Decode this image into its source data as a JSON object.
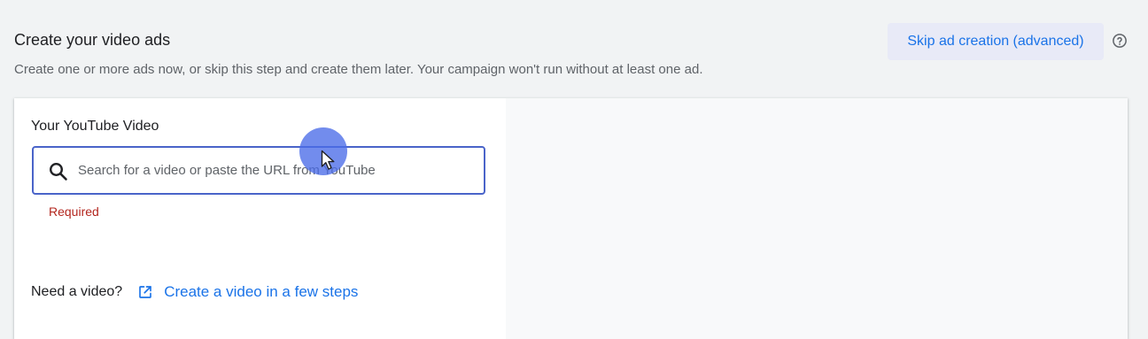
{
  "header": {
    "title": "Create your video ads",
    "subtitle": "Create one or more ads now, or skip this step and create them later. Your campaign won't run without at least one ad.",
    "skip_label": "Skip ad creation (advanced)",
    "help_icon": "help-circle-icon"
  },
  "video_card": {
    "label": "Your YouTube Video",
    "search": {
      "placeholder": "Search for a video or paste the URL from YouTube",
      "value": "",
      "icon": "search-icon"
    },
    "error": "Required",
    "need_video_text": "Need a video?",
    "create_link_icon": "open-in-new-icon",
    "create_link_label": "Create a video in a few steps"
  },
  "colors": {
    "accent": "#1a73e8",
    "focus_border": "#4a64c9",
    "error": "#b3261e",
    "background": "#f1f3f4"
  }
}
